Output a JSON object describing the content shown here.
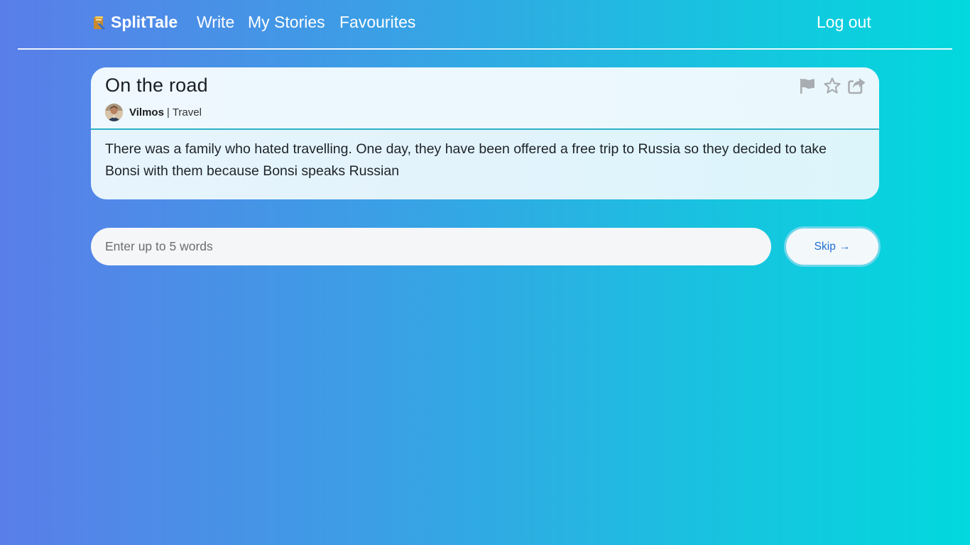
{
  "nav": {
    "brand": "SplitTale",
    "links": {
      "write": "Write",
      "my_stories": "My Stories",
      "favourites": "Favourites",
      "logout": "Log out"
    }
  },
  "story": {
    "title": "On the road",
    "author": "Vilmos",
    "separator": "|",
    "category": "Travel",
    "text": "There was a family who hated travelling. One day, they have been offered a free trip to Russia so they decided to take Bonsi with them because Bonsi speaks Russian",
    "actions": [
      "flag-icon",
      "star-icon",
      "share-icon"
    ]
  },
  "input": {
    "placeholder": "Enter up to 5 words",
    "value": ""
  },
  "skip": {
    "label": "Skip",
    "arrow": "→"
  },
  "colors": {
    "accent_text": "#1f6fd0",
    "divider": "#2bb2c4",
    "icon_gray": "#a9adb1"
  }
}
